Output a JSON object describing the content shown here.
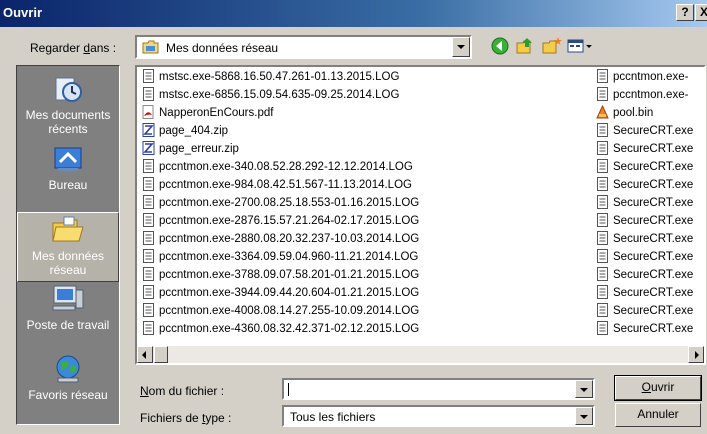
{
  "window": {
    "title": "Ouvrir",
    "help_btn": "?",
    "close_btn": "X"
  },
  "lookin": {
    "label_pre": "Regarder ",
    "label_u": "d",
    "label_post": "ans :",
    "value": "Mes données réseau"
  },
  "toolbar": [
    "back-icon",
    "up-folder-icon",
    "new-folder-icon",
    "view-menu-icon"
  ],
  "places": [
    {
      "label": "Mes documents récents",
      "icon": "recent-documents-icon"
    },
    {
      "label": "Bureau",
      "icon": "desktop-icon"
    },
    {
      "label": "Mes données réseau",
      "icon": "my-data-icon"
    },
    {
      "label": "Poste de travail",
      "icon": "my-computer-icon"
    },
    {
      "label": "Favoris réseau",
      "icon": "network-favorites-icon"
    }
  ],
  "files_col1": [
    {
      "name": "mstsc.exe-5868.16.50.47.261-01.13.2015.LOG",
      "type": "log"
    },
    {
      "name": "mstsc.exe-6856.15.09.54.635-09.25.2014.LOG",
      "type": "log"
    },
    {
      "name": "NapperonEnCours.pdf",
      "type": "pdf"
    },
    {
      "name": "page_404.zip",
      "type": "zip"
    },
    {
      "name": "page_erreur.zip",
      "type": "zip"
    },
    {
      "name": "pccntmon.exe-340.08.52.28.292-12.12.2014.LOG",
      "type": "log"
    },
    {
      "name": "pccntmon.exe-984.08.42.51.567-11.13.2014.LOG",
      "type": "log"
    },
    {
      "name": "pccntmon.exe-2700.08.25.18.553-01.16.2015.LOG",
      "type": "log"
    },
    {
      "name": "pccntmon.exe-2876.15.57.21.264-02.17.2015.LOG",
      "type": "log"
    },
    {
      "name": "pccntmon.exe-2880.08.20.32.237-10.03.2014.LOG",
      "type": "log"
    },
    {
      "name": "pccntmon.exe-3364.09.59.04.960-11.21.2014.LOG",
      "type": "log"
    },
    {
      "name": "pccntmon.exe-3788.09.07.58.201-01.21.2015.LOG",
      "type": "log"
    },
    {
      "name": "pccntmon.exe-3944.09.44.20.604-01.21.2015.LOG",
      "type": "log"
    },
    {
      "name": "pccntmon.exe-4008.08.14.27.255-10.09.2014.LOG",
      "type": "log"
    },
    {
      "name": "pccntmon.exe-4360.08.32.42.371-02.12.2015.LOG",
      "type": "log"
    }
  ],
  "files_col2": [
    {
      "name": "pccntmon.exe-",
      "type": "log"
    },
    {
      "name": "pccntmon.exe-",
      "type": "log"
    },
    {
      "name": "pool.bin",
      "type": "bin"
    },
    {
      "name": "SecureCRT.exe",
      "type": "log"
    },
    {
      "name": "SecureCRT.exe",
      "type": "log"
    },
    {
      "name": "SecureCRT.exe",
      "type": "log"
    },
    {
      "name": "SecureCRT.exe",
      "type": "log"
    },
    {
      "name": "SecureCRT.exe",
      "type": "log"
    },
    {
      "name": "SecureCRT.exe",
      "type": "log"
    },
    {
      "name": "SecureCRT.exe",
      "type": "log"
    },
    {
      "name": "SecureCRT.exe",
      "type": "log"
    },
    {
      "name": "SecureCRT.exe",
      "type": "log"
    },
    {
      "name": "SecureCRT.exe",
      "type": "log"
    },
    {
      "name": "SecureCRT.exe",
      "type": "log"
    },
    {
      "name": "SecureCRT.exe",
      "type": "log"
    }
  ],
  "filename": {
    "label_u": "N",
    "label_post": "om du fichier :",
    "value": ""
  },
  "filetype": {
    "label_pre": "Fichiers de ",
    "label_u": "t",
    "label_post": "ype :",
    "value": "Tous les fichiers"
  },
  "buttons": {
    "open_u": "O",
    "open_post": "uvrir",
    "cancel": "Annuler"
  }
}
